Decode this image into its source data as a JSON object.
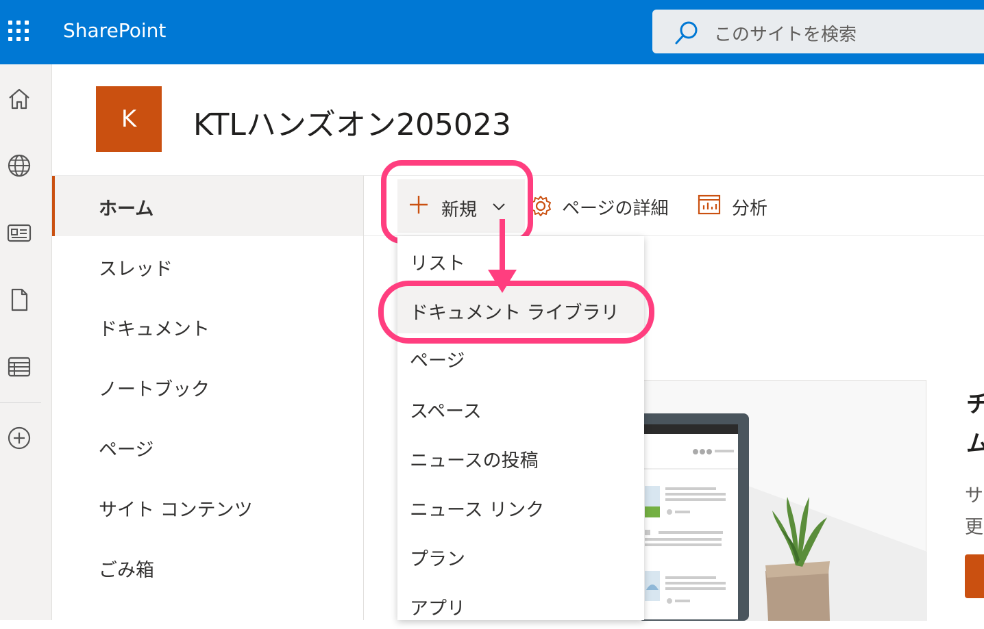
{
  "header": {
    "app_name": "SharePoint",
    "search_placeholder": "このサイトを検索"
  },
  "rail": {
    "items": [
      "home",
      "sites",
      "news",
      "files",
      "lists",
      "create"
    ]
  },
  "site": {
    "logo_letter": "K",
    "title": "KTLハンズオン205023"
  },
  "leftnav": {
    "items": [
      {
        "label": "ホーム",
        "active": true
      },
      {
        "label": "スレッド"
      },
      {
        "label": "ドキュメント"
      },
      {
        "label": "ノートブック"
      },
      {
        "label": "ページ"
      },
      {
        "label": "サイト コンテンツ"
      },
      {
        "label": "ごみ箱"
      }
    ]
  },
  "commandbar": {
    "new_label": "新規",
    "page_details_label": "ページの詳細",
    "analytics_label": "分析"
  },
  "new_menu": {
    "items": [
      "リスト",
      "ドキュメント ライブラリ",
      "ページ",
      "スペース",
      "ニュースの投稿",
      "ニュース リンク",
      "プラン",
      "アプリ"
    ],
    "highlighted": "ドキュメント ライブラリ"
  },
  "main": {
    "title_partial": "チ\nム",
    "desc_partial": "サ\n更"
  },
  "colors": {
    "suite": "#0078d4",
    "accent": "#ca5010",
    "highlight": "#ff3e7f"
  }
}
